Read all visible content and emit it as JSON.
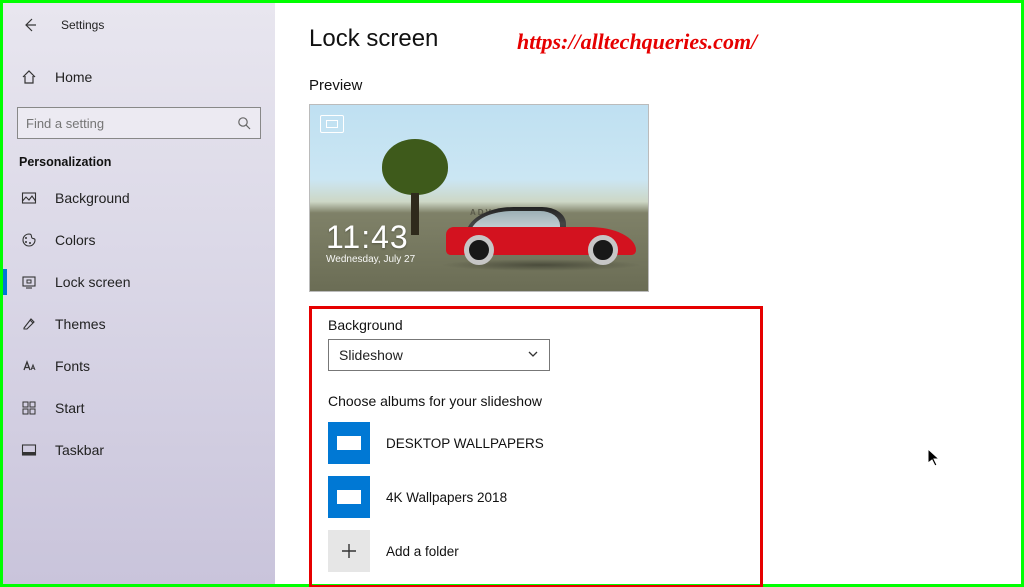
{
  "window": {
    "title": "Settings"
  },
  "watermark": "https://alltechqueries.com/",
  "sidebar": {
    "home": "Home",
    "search_placeholder": "Find a setting",
    "section": "Personalization",
    "items": [
      {
        "label": "Background"
      },
      {
        "label": "Colors"
      },
      {
        "label": "Lock screen",
        "active": true
      },
      {
        "label": "Themes"
      },
      {
        "label": "Fonts"
      },
      {
        "label": "Start"
      },
      {
        "label": "Taskbar"
      }
    ]
  },
  "main": {
    "title": "Lock screen",
    "preview_label": "Preview",
    "preview": {
      "time": "11:43",
      "date": "Wednesday, July 27",
      "banner": "ADV.1"
    },
    "background": {
      "label": "Background",
      "selected": "Slideshow"
    },
    "albums": {
      "label": "Choose albums for your slideshow",
      "items": [
        {
          "name": "DESKTOP WALLPAPERS"
        },
        {
          "name": "4K Wallpapers 2018"
        }
      ],
      "add_label": "Add a folder"
    }
  }
}
